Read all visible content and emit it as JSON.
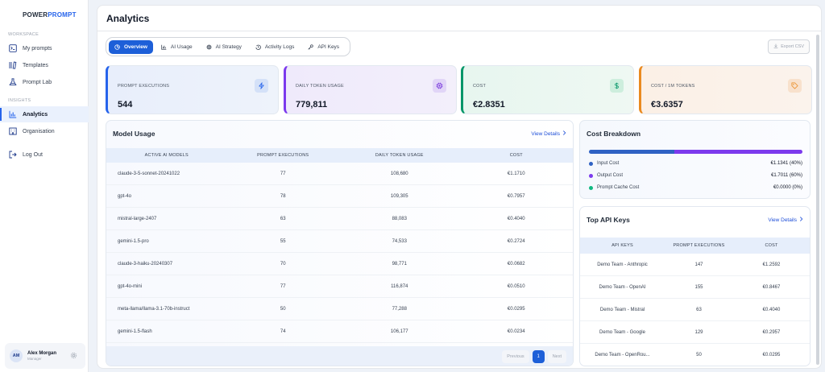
{
  "app": {
    "logo_main": "POWER",
    "logo_accent": "PROMPT"
  },
  "sidebar": {
    "workspace_label": "WORKSPACE",
    "insights_label": "INSIGHTS",
    "items": [
      {
        "label": "My prompts",
        "icon": "prompt-icon"
      },
      {
        "label": "Templates",
        "icon": "templates-icon"
      },
      {
        "label": "Prompt Lab",
        "icon": "flask-icon"
      },
      {
        "label": "Analytics",
        "icon": "chart-icon",
        "active": true
      },
      {
        "label": "Organisation",
        "icon": "building-icon"
      },
      {
        "label": "Log Out",
        "icon": "logout-icon"
      }
    ],
    "user": {
      "initials": "AM",
      "name": "Alex Morgan",
      "role": "Manager"
    }
  },
  "header": {
    "title": "Analytics"
  },
  "tabs": [
    {
      "label": "Overview",
      "active": true
    },
    {
      "label": "AI Usage"
    },
    {
      "label": "AI Strategy"
    },
    {
      "label": "Activity Logs"
    },
    {
      "label": "API Keys"
    }
  ],
  "export_label": "Export CSV",
  "stats": [
    {
      "label": "PROMPT EXECUTIONS",
      "value": "544",
      "icon": "bolt-icon",
      "accent": "#2563eb"
    },
    {
      "label": "DAILY TOKEN USAGE",
      "value": "779,811",
      "icon": "chip-icon",
      "accent": "#7c3aed"
    },
    {
      "label": "COST",
      "value": "€2.8351",
      "icon": "dollar-icon",
      "accent": "#059669"
    },
    {
      "label": "COST / 1M TOKENS",
      "value": "€3.6357",
      "icon": "tag-icon",
      "accent": "#ea8a1f"
    }
  ],
  "model_usage": {
    "title": "Model Usage",
    "link": "View Details",
    "columns": [
      "ACTIVE AI MODELS",
      "PROMPT EXECUTIONS",
      "DAILY TOKEN USAGE",
      "COST"
    ],
    "rows": [
      [
        "claude-3-5-sonnet-20241022",
        "77",
        "108,680",
        "€1.1710"
      ],
      [
        "gpt-4o",
        "78",
        "109,305",
        "€0.7957"
      ],
      [
        "mistral-large-2407",
        "63",
        "88,083",
        "€0.4040"
      ],
      [
        "gemini-1.5-pro",
        "55",
        "74,533",
        "€0.2724"
      ],
      [
        "claude-3-haiku-20240307",
        "70",
        "98,771",
        "€0.0682"
      ],
      [
        "gpt-4o-mini",
        "77",
        "116,874",
        "€0.0510"
      ],
      [
        "meta-llama/llama-3.1-70b-instruct",
        "50",
        "77,288",
        "€0.0295"
      ],
      [
        "gemini-1.5-flash",
        "74",
        "106,177",
        "€0.0234"
      ]
    ],
    "pager": {
      "previous": "Previous",
      "page": "1",
      "next": "Next"
    }
  },
  "cost_breakdown": {
    "title": "Cost Breakdown",
    "items": [
      {
        "label": "Input Cost",
        "value": "€1.1341 (40%)",
        "color": "#2f62c4",
        "share": 0.4
      },
      {
        "label": "Output Cost",
        "value": "€1.7011 (60%)",
        "color": "#7c3aed",
        "share": 0.6
      },
      {
        "label": "Prompt Cache Cost",
        "value": "€0.0000 (0%)",
        "color": "#10b981",
        "share": 0
      }
    ]
  },
  "api_keys": {
    "title": "Top API Keys",
    "link": "View Details",
    "columns": [
      "API KEYS",
      "PROMPT EXECUTIONS",
      "COST"
    ],
    "rows": [
      [
        "Demo Team - Anthropic",
        "147",
        "€1.2592"
      ],
      [
        "Demo Team - OpenAI",
        "155",
        "€0.8467"
      ],
      [
        "Demo Team - Mistral",
        "63",
        "€0.4040"
      ],
      [
        "Demo Team - Google",
        "129",
        "€0.2957"
      ],
      [
        "Demo Team - OpenRou...",
        "50",
        "€0.0295"
      ]
    ]
  }
}
